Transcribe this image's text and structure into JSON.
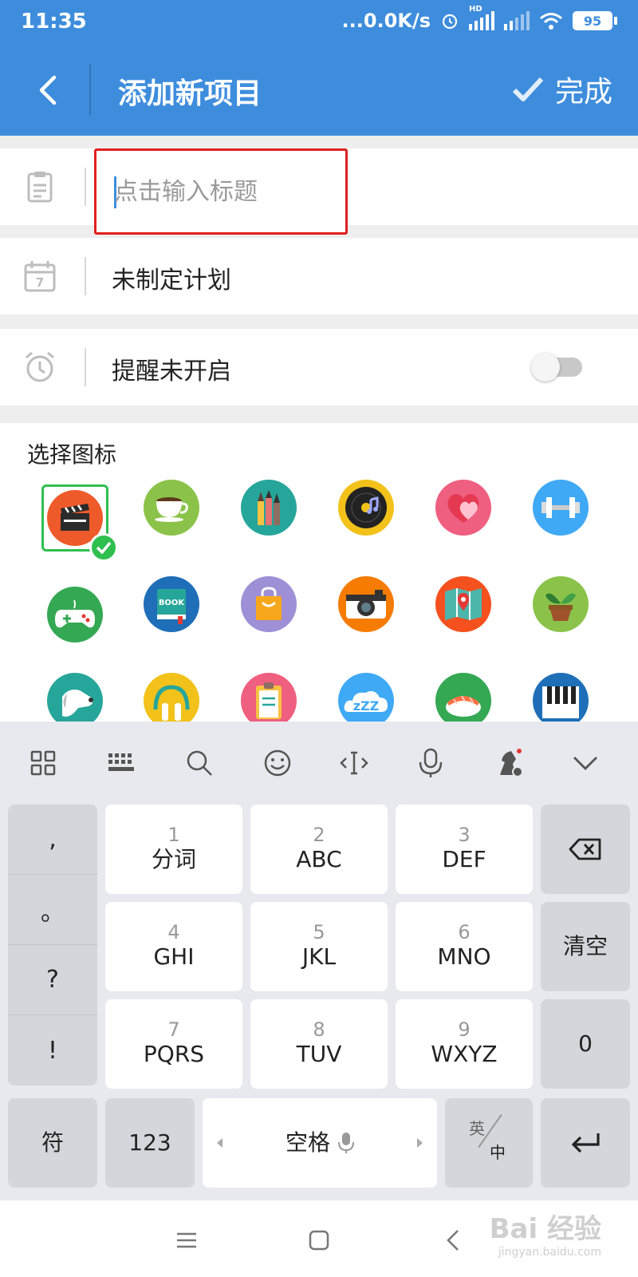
{
  "status_bar": {
    "time": "11:35",
    "network_speed": "...0.0K/s",
    "battery": "95",
    "hd_label": "HD"
  },
  "header": {
    "title": "添加新项目",
    "done_label": "完成"
  },
  "form": {
    "title_placeholder": "点击输入标题",
    "plan_text": "未制定计划",
    "reminder_text": "提醒未开启",
    "reminder_enabled": false,
    "calendar_day": "7"
  },
  "icon_picker": {
    "section_title": "选择图标",
    "selected_icon": "clapperboard-icon",
    "icons": [
      "clapperboard-icon",
      "coffee-cup-icon",
      "pens-icon",
      "vinyl-record-icon",
      "heart-icon",
      "dumbbell-icon",
      "gamepad-icon",
      "book-icon",
      "shopping-bag-icon",
      "camera-icon",
      "map-icon",
      "plant-icon",
      "dog-icon",
      "headphones-icon",
      "clipboard-icon",
      "sleep-icon",
      "sushi-icon",
      "piano-icon"
    ],
    "book_label": "BOOK",
    "sleep_label": "zZZ"
  },
  "keyboard": {
    "toolbar": [
      "grid-icon",
      "keyboard-icon",
      "search-icon",
      "emoji-icon",
      "cursor-move-icon",
      "microphone-icon",
      "chess-knight-icon",
      "collapse-chevron-icon"
    ],
    "punctuation": [
      ",",
      "。",
      "?",
      "!"
    ],
    "keys": [
      {
        "num": "1",
        "label": "分词"
      },
      {
        "num": "2",
        "label": "ABC"
      },
      {
        "num": "3",
        "label": "DEF"
      },
      {
        "num": "4",
        "label": "GHI"
      },
      {
        "num": "5",
        "label": "JKL"
      },
      {
        "num": "6",
        "label": "MNO"
      },
      {
        "num": "7",
        "label": "PQRS"
      },
      {
        "num": "8",
        "label": "TUV"
      },
      {
        "num": "9",
        "label": "WXYZ"
      }
    ],
    "clear_label": "清空",
    "zero_label": "0",
    "symbol_label": "符",
    "numbers_label": "123",
    "space_label": "空格",
    "lang_top": "英",
    "lang_bottom": "中"
  },
  "watermark": {
    "text": "Bai 经验",
    "url": "jingyan.baidu.com"
  },
  "colors": {
    "header_blue": "#3e8ddd",
    "selection_green": "#2fbf4f",
    "highlight_red": "#e02020"
  }
}
